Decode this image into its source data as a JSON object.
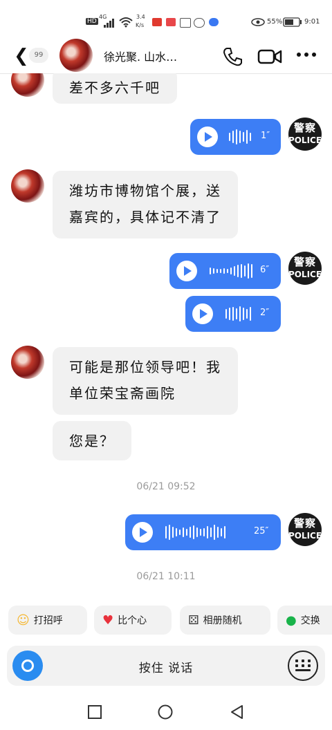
{
  "statusbar": {
    "hd": "HD",
    "signal": "4G",
    "net_speed": "3.4",
    "net_unit": "K/s",
    "battery": "55%",
    "time": "9:01"
  },
  "header": {
    "unread_count": "99",
    "title": "徐光聚. 山水…"
  },
  "messages": {
    "m1": "差不多六千吧",
    "v1_duration": "1″",
    "m2_line1": "潍坊市博物馆个展，送",
    "m2_line2": "嘉宾的，具体记不清了",
    "v2_duration": "6″",
    "v3_duration": "2″",
    "m3_line1": "可能是那位领导吧！我",
    "m3_line2": "单位荣宝斋画院",
    "m4": "您是？",
    "ts1": "06/21 09:52",
    "v4_duration": "25″",
    "ts2": "06/21 10:11"
  },
  "police_avatar": {
    "top": "警察",
    "bottom": "POLICE"
  },
  "quick_replies": [
    {
      "icon": "wave-hand-icon",
      "label": "打招呼"
    },
    {
      "icon": "heart-icon",
      "label": "比个心"
    },
    {
      "icon": "dice-icon",
      "label": "相册随机"
    },
    {
      "icon": "location-icon",
      "label": "交换"
    }
  ],
  "input": {
    "press_to_talk": "按住 说话"
  },
  "colors": {
    "voice_bubble": "#3d7ef5",
    "incoming_bubble": "#f1f1f1",
    "mic_button": "#2a8cf0"
  }
}
